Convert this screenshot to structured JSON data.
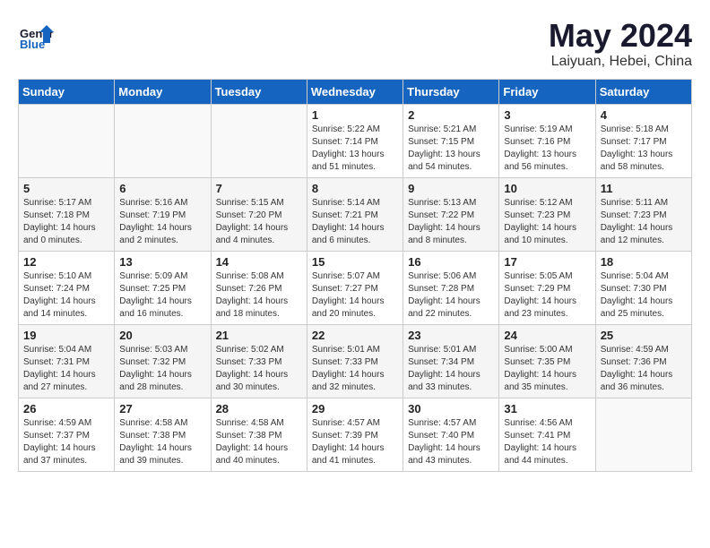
{
  "header": {
    "logo_line1": "General",
    "logo_line2": "Blue",
    "month": "May 2024",
    "location": "Laiyuan, Hebei, China"
  },
  "days_of_week": [
    "Sunday",
    "Monday",
    "Tuesday",
    "Wednesday",
    "Thursday",
    "Friday",
    "Saturday"
  ],
  "weeks": [
    [
      {
        "num": "",
        "empty": true
      },
      {
        "num": "",
        "empty": true
      },
      {
        "num": "",
        "empty": true
      },
      {
        "num": "1",
        "info": "Sunrise: 5:22 AM\nSunset: 7:14 PM\nDaylight: 13 hours\nand 51 minutes."
      },
      {
        "num": "2",
        "info": "Sunrise: 5:21 AM\nSunset: 7:15 PM\nDaylight: 13 hours\nand 54 minutes."
      },
      {
        "num": "3",
        "info": "Sunrise: 5:19 AM\nSunset: 7:16 PM\nDaylight: 13 hours\nand 56 minutes."
      },
      {
        "num": "4",
        "info": "Sunrise: 5:18 AM\nSunset: 7:17 PM\nDaylight: 13 hours\nand 58 minutes."
      }
    ],
    [
      {
        "num": "5",
        "info": "Sunrise: 5:17 AM\nSunset: 7:18 PM\nDaylight: 14 hours\nand 0 minutes."
      },
      {
        "num": "6",
        "info": "Sunrise: 5:16 AM\nSunset: 7:19 PM\nDaylight: 14 hours\nand 2 minutes."
      },
      {
        "num": "7",
        "info": "Sunrise: 5:15 AM\nSunset: 7:20 PM\nDaylight: 14 hours\nand 4 minutes."
      },
      {
        "num": "8",
        "info": "Sunrise: 5:14 AM\nSunset: 7:21 PM\nDaylight: 14 hours\nand 6 minutes."
      },
      {
        "num": "9",
        "info": "Sunrise: 5:13 AM\nSunset: 7:22 PM\nDaylight: 14 hours\nand 8 minutes."
      },
      {
        "num": "10",
        "info": "Sunrise: 5:12 AM\nSunset: 7:23 PM\nDaylight: 14 hours\nand 10 minutes."
      },
      {
        "num": "11",
        "info": "Sunrise: 5:11 AM\nSunset: 7:23 PM\nDaylight: 14 hours\nand 12 minutes."
      }
    ],
    [
      {
        "num": "12",
        "info": "Sunrise: 5:10 AM\nSunset: 7:24 PM\nDaylight: 14 hours\nand 14 minutes."
      },
      {
        "num": "13",
        "info": "Sunrise: 5:09 AM\nSunset: 7:25 PM\nDaylight: 14 hours\nand 16 minutes."
      },
      {
        "num": "14",
        "info": "Sunrise: 5:08 AM\nSunset: 7:26 PM\nDaylight: 14 hours\nand 18 minutes."
      },
      {
        "num": "15",
        "info": "Sunrise: 5:07 AM\nSunset: 7:27 PM\nDaylight: 14 hours\nand 20 minutes."
      },
      {
        "num": "16",
        "info": "Sunrise: 5:06 AM\nSunset: 7:28 PM\nDaylight: 14 hours\nand 22 minutes."
      },
      {
        "num": "17",
        "info": "Sunrise: 5:05 AM\nSunset: 7:29 PM\nDaylight: 14 hours\nand 23 minutes."
      },
      {
        "num": "18",
        "info": "Sunrise: 5:04 AM\nSunset: 7:30 PM\nDaylight: 14 hours\nand 25 minutes."
      }
    ],
    [
      {
        "num": "19",
        "info": "Sunrise: 5:04 AM\nSunset: 7:31 PM\nDaylight: 14 hours\nand 27 minutes."
      },
      {
        "num": "20",
        "info": "Sunrise: 5:03 AM\nSunset: 7:32 PM\nDaylight: 14 hours\nand 28 minutes."
      },
      {
        "num": "21",
        "info": "Sunrise: 5:02 AM\nSunset: 7:33 PM\nDaylight: 14 hours\nand 30 minutes."
      },
      {
        "num": "22",
        "info": "Sunrise: 5:01 AM\nSunset: 7:33 PM\nDaylight: 14 hours\nand 32 minutes."
      },
      {
        "num": "23",
        "info": "Sunrise: 5:01 AM\nSunset: 7:34 PM\nDaylight: 14 hours\nand 33 minutes."
      },
      {
        "num": "24",
        "info": "Sunrise: 5:00 AM\nSunset: 7:35 PM\nDaylight: 14 hours\nand 35 minutes."
      },
      {
        "num": "25",
        "info": "Sunrise: 4:59 AM\nSunset: 7:36 PM\nDaylight: 14 hours\nand 36 minutes."
      }
    ],
    [
      {
        "num": "26",
        "info": "Sunrise: 4:59 AM\nSunset: 7:37 PM\nDaylight: 14 hours\nand 37 minutes."
      },
      {
        "num": "27",
        "info": "Sunrise: 4:58 AM\nSunset: 7:38 PM\nDaylight: 14 hours\nand 39 minutes."
      },
      {
        "num": "28",
        "info": "Sunrise: 4:58 AM\nSunset: 7:38 PM\nDaylight: 14 hours\nand 40 minutes."
      },
      {
        "num": "29",
        "info": "Sunrise: 4:57 AM\nSunset: 7:39 PM\nDaylight: 14 hours\nand 41 minutes."
      },
      {
        "num": "30",
        "info": "Sunrise: 4:57 AM\nSunset: 7:40 PM\nDaylight: 14 hours\nand 43 minutes."
      },
      {
        "num": "31",
        "info": "Sunrise: 4:56 AM\nSunset: 7:41 PM\nDaylight: 14 hours\nand 44 minutes."
      },
      {
        "num": "",
        "empty": true
      }
    ]
  ]
}
